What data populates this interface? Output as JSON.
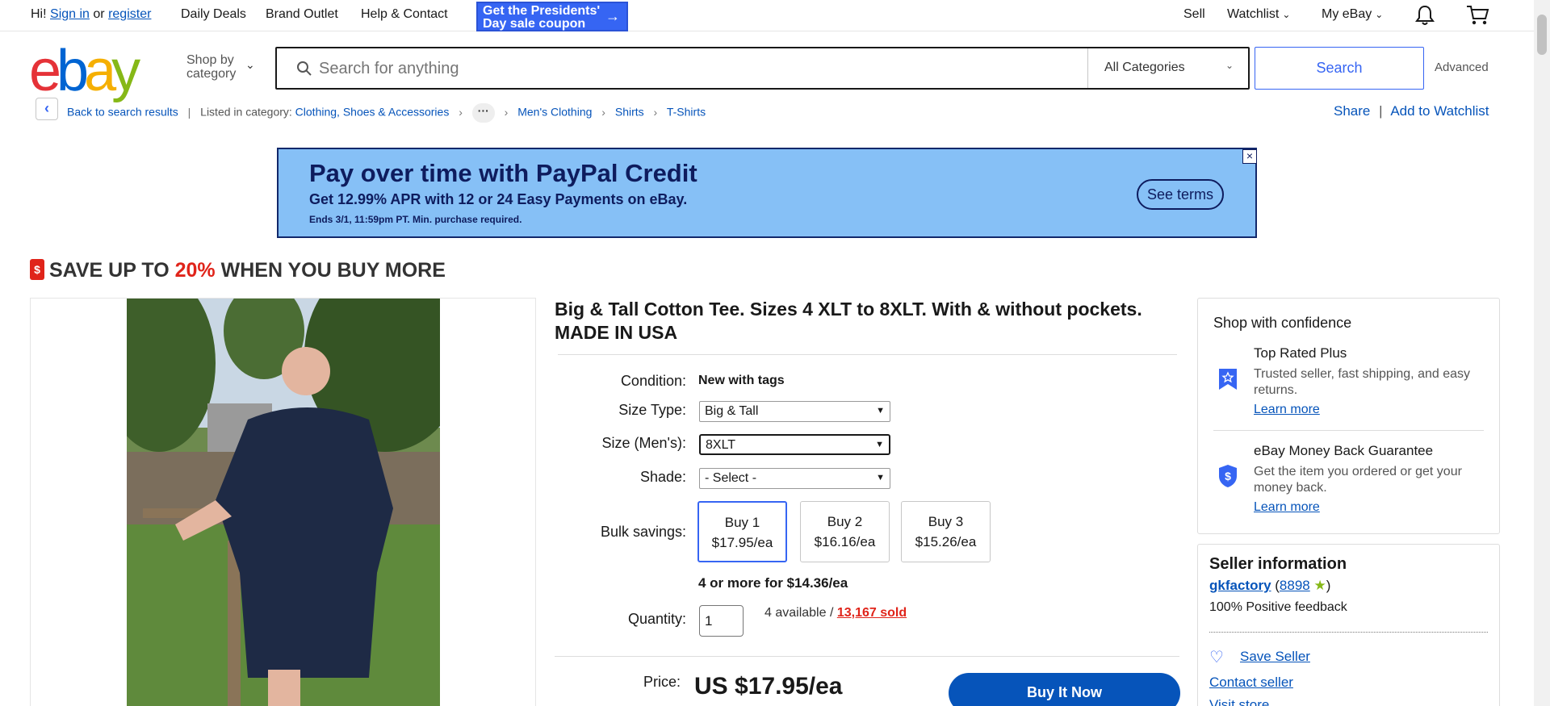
{
  "topbar": {
    "greeting": "Hi!",
    "sign_in": "Sign in",
    "or": "or",
    "register": "register",
    "daily_deals": "Daily Deals",
    "brand_outlet": "Brand Outlet",
    "help_contact": "Help & Contact",
    "promo_line1": "Get the Presidents'",
    "promo_line2": "Day sale coupon",
    "sell": "Sell",
    "watchlist": "Watchlist",
    "my_ebay": "My eBay"
  },
  "header": {
    "logo": [
      "e",
      "b",
      "a",
      "y"
    ],
    "shop_by_line1": "Shop by",
    "shop_by_line2": "category",
    "search_placeholder": "Search for anything",
    "category_select": "All Categories",
    "search_button": "Search",
    "advanced": "Advanced"
  },
  "breadcrumb": {
    "back": "Back to search results",
    "listed_in": "Listed in category:",
    "items": [
      "Clothing, Shoes & Accessories",
      "Men's Clothing",
      "Shirts",
      "T-Shirts"
    ],
    "share": "Share",
    "add_watchlist": "Add to Watchlist"
  },
  "ad": {
    "title": "Pay over time with PayPal Credit",
    "subtitle": "Get 12.99% APR with 12 or 24 Easy Payments on eBay.",
    "small": "Ends 3/1, 11:59pm PT. Min. purchase required.",
    "terms": "See terms"
  },
  "save": {
    "prefix": "SAVE UP TO",
    "percent": "20%",
    "suffix": "WHEN YOU BUY MORE"
  },
  "item": {
    "title": "Big & Tall Cotton Tee. Sizes 4 XLT to 8XLT. With & without pockets. MADE IN USA",
    "condition_label": "Condition:",
    "condition_value": "New with tags",
    "size_type_label": "Size Type:",
    "size_type_value": "Big & Tall",
    "size_label": "Size (Men's):",
    "size_value": "8XLT",
    "shade_label": "Shade:",
    "shade_value": "- Select -",
    "bulk_label": "Bulk savings:",
    "bulk": [
      {
        "qty": "Buy 1",
        "price": "$17.95/ea"
      },
      {
        "qty": "Buy 2",
        "price": "$16.16/ea"
      },
      {
        "qty": "Buy 3",
        "price": "$15.26/ea"
      }
    ],
    "more": "4 or more for $14.36/ea",
    "quantity_label": "Quantity:",
    "quantity_value": "1",
    "available": "4 available /",
    "sold": "13,167 sold",
    "price_label": "Price:",
    "price": "US $17.95/ea",
    "buy_now": "Buy It Now"
  },
  "confidence": {
    "heading": "Shop with confidence",
    "top_rated_title": "Top Rated Plus",
    "top_rated_desc": "Trusted seller, fast shipping, and easy returns.",
    "learn_more": "Learn more",
    "mbg_title": "eBay Money Back Guarantee",
    "mbg_desc": "Get the item you ordered or get your money back."
  },
  "seller": {
    "heading": "Seller information",
    "name": "gkfactory",
    "score": "8898",
    "feedback": "100% Positive feedback",
    "save_seller": "Save Seller",
    "contact": "Contact seller",
    "visit": "Visit store"
  },
  "colors": {
    "accent": "#3665f3",
    "link": "#0654ba",
    "ad_bg": "#86c0f6",
    "sale_red": "#e0241a"
  }
}
